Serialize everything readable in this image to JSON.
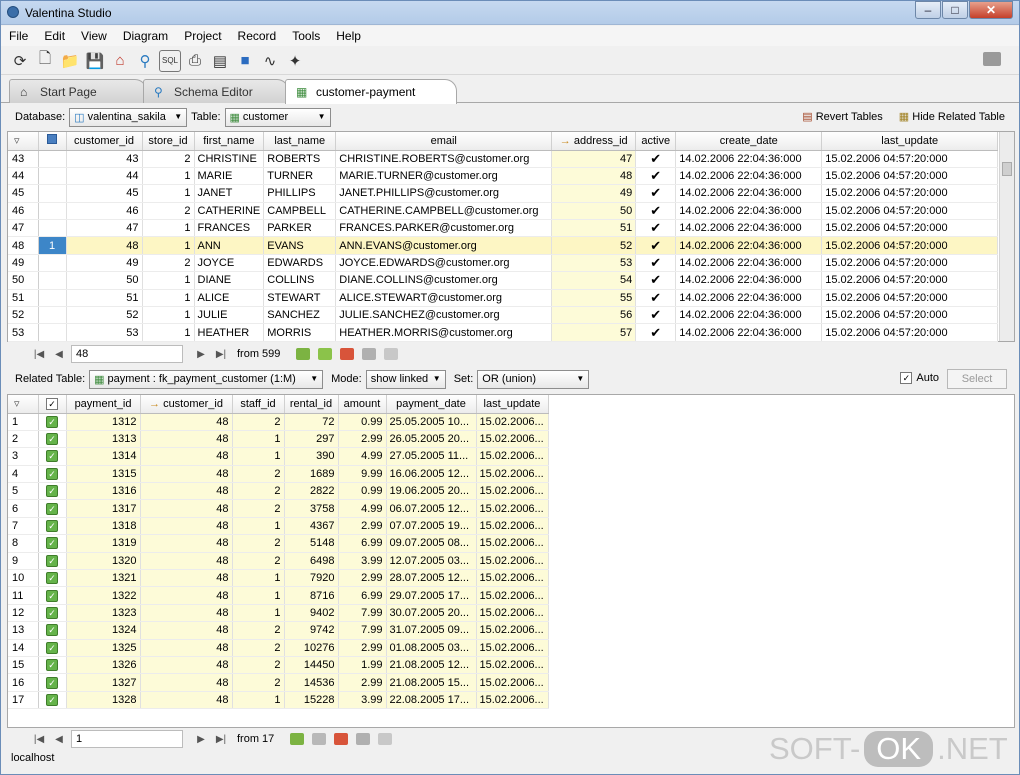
{
  "window": {
    "title": "Valentina Studio"
  },
  "menu": [
    "File",
    "Edit",
    "View",
    "Diagram",
    "Project",
    "Record",
    "Tools",
    "Help"
  ],
  "toolbar_icons": [
    "refresh-icon",
    "new-file-icon",
    "open-folder-icon",
    "save-icon",
    "home-icon",
    "search-icon",
    "sql-icon",
    "print-icon",
    "report-icon",
    "book-icon",
    "chart-icon",
    "wand-icon"
  ],
  "tabs": [
    {
      "label": "Start Page",
      "icon": "home-icon"
    },
    {
      "label": "Schema Editor",
      "icon": "schema-icon"
    },
    {
      "label": "customer-payment",
      "icon": "table-icon"
    }
  ],
  "dbbar": {
    "database_label": "Database:",
    "database_value": "valentina_sakila",
    "table_label": "Table:",
    "table_value": "customer",
    "revert": "Revert Tables",
    "hide": "Hide Related Table"
  },
  "customer": {
    "columns": [
      "customer_id",
      "store_id",
      "first_name",
      "last_name",
      "email",
      "address_id",
      "active",
      "create_date",
      "last_update"
    ],
    "rows": [
      {
        "rn": "43",
        "customer_id": "43",
        "store_id": "2",
        "first_name": "CHRISTINE",
        "last_name": "ROBERTS",
        "email": "CHRISTINE.ROBERTS@customer.org",
        "address_id": "47",
        "create_date": "14.02.2006 22:04:36:000",
        "last_update": "15.02.2006 04:57:20:000"
      },
      {
        "rn": "44",
        "customer_id": "44",
        "store_id": "1",
        "first_name": "MARIE",
        "last_name": "TURNER",
        "email": "MARIE.TURNER@customer.org",
        "address_id": "48",
        "create_date": "14.02.2006 22:04:36:000",
        "last_update": "15.02.2006 04:57:20:000"
      },
      {
        "rn": "45",
        "customer_id": "45",
        "store_id": "1",
        "first_name": "JANET",
        "last_name": "PHILLIPS",
        "email": "JANET.PHILLIPS@customer.org",
        "address_id": "49",
        "create_date": "14.02.2006 22:04:36:000",
        "last_update": "15.02.2006 04:57:20:000"
      },
      {
        "rn": "46",
        "customer_id": "46",
        "store_id": "2",
        "first_name": "CATHERINE",
        "last_name": "CAMPBELL",
        "email": "CATHERINE.CAMPBELL@customer.org",
        "address_id": "50",
        "create_date": "14.02.2006 22:04:36:000",
        "last_update": "15.02.2006 04:57:20:000"
      },
      {
        "rn": "47",
        "customer_id": "47",
        "store_id": "1",
        "first_name": "FRANCES",
        "last_name": "PARKER",
        "email": "FRANCES.PARKER@customer.org",
        "address_id": "51",
        "create_date": "14.02.2006 22:04:36:000",
        "last_update": "15.02.2006 04:57:20:000"
      },
      {
        "rn": "48",
        "customer_id": "48",
        "store_id": "1",
        "first_name": "ANN",
        "last_name": "EVANS",
        "email": "ANN.EVANS@customer.org",
        "address_id": "52",
        "create_date": "14.02.2006 22:04:36:000",
        "last_update": "15.02.2006 04:57:20:000",
        "selected": true,
        "marker": "1"
      },
      {
        "rn": "49",
        "customer_id": "49",
        "store_id": "2",
        "first_name": "JOYCE",
        "last_name": "EDWARDS",
        "email": "JOYCE.EDWARDS@customer.org",
        "address_id": "53",
        "create_date": "14.02.2006 22:04:36:000",
        "last_update": "15.02.2006 04:57:20:000"
      },
      {
        "rn": "50",
        "customer_id": "50",
        "store_id": "1",
        "first_name": "DIANE",
        "last_name": "COLLINS",
        "email": "DIANE.COLLINS@customer.org",
        "address_id": "54",
        "create_date": "14.02.2006 22:04:36:000",
        "last_update": "15.02.2006 04:57:20:000"
      },
      {
        "rn": "51",
        "customer_id": "51",
        "store_id": "1",
        "first_name": "ALICE",
        "last_name": "STEWART",
        "email": "ALICE.STEWART@customer.org",
        "address_id": "55",
        "create_date": "14.02.2006 22:04:36:000",
        "last_update": "15.02.2006 04:57:20:000"
      },
      {
        "rn": "52",
        "customer_id": "52",
        "store_id": "1",
        "first_name": "JULIE",
        "last_name": "SANCHEZ",
        "email": "JULIE.SANCHEZ@customer.org",
        "address_id": "56",
        "create_date": "14.02.2006 22:04:36:000",
        "last_update": "15.02.2006 04:57:20:000"
      },
      {
        "rn": "53",
        "customer_id": "53",
        "store_id": "1",
        "first_name": "HEATHER",
        "last_name": "MORRIS",
        "email": "HEATHER.MORRIS@customer.org",
        "address_id": "57",
        "create_date": "14.02.2006 22:04:36:000",
        "last_update": "15.02.2006 04:57:20:000"
      }
    ]
  },
  "nav1": {
    "value": "48",
    "from": "from 599"
  },
  "relbar": {
    "related_label": "Related Table:",
    "related_value": "payment : fk_payment_customer (1:M)",
    "mode_label": "Mode:",
    "mode_value": "show linked",
    "set_label": "Set:",
    "set_value": "OR (union)",
    "auto": "Auto",
    "select": "Select"
  },
  "payment": {
    "columns": [
      "payment_id",
      "customer_id",
      "staff_id",
      "rental_id",
      "amount",
      "payment_date",
      "last_update"
    ],
    "rows": [
      {
        "rn": "1",
        "payment_id": "1312",
        "customer_id": "48",
        "staff_id": "2",
        "rental_id": "72",
        "amount": "0.99",
        "payment_date": "25.05.2005 10...",
        "last_update": "15.02.2006..."
      },
      {
        "rn": "2",
        "payment_id": "1313",
        "customer_id": "48",
        "staff_id": "1",
        "rental_id": "297",
        "amount": "2.99",
        "payment_date": "26.05.2005 20...",
        "last_update": "15.02.2006..."
      },
      {
        "rn": "3",
        "payment_id": "1314",
        "customer_id": "48",
        "staff_id": "1",
        "rental_id": "390",
        "amount": "4.99",
        "payment_date": "27.05.2005 11...",
        "last_update": "15.02.2006..."
      },
      {
        "rn": "4",
        "payment_id": "1315",
        "customer_id": "48",
        "staff_id": "2",
        "rental_id": "1689",
        "amount": "9.99",
        "payment_date": "16.06.2005 12...",
        "last_update": "15.02.2006..."
      },
      {
        "rn": "5",
        "payment_id": "1316",
        "customer_id": "48",
        "staff_id": "2",
        "rental_id": "2822",
        "amount": "0.99",
        "payment_date": "19.06.2005 20...",
        "last_update": "15.02.2006..."
      },
      {
        "rn": "6",
        "payment_id": "1317",
        "customer_id": "48",
        "staff_id": "2",
        "rental_id": "3758",
        "amount": "4.99",
        "payment_date": "06.07.2005 12...",
        "last_update": "15.02.2006..."
      },
      {
        "rn": "7",
        "payment_id": "1318",
        "customer_id": "48",
        "staff_id": "1",
        "rental_id": "4367",
        "amount": "2.99",
        "payment_date": "07.07.2005 19...",
        "last_update": "15.02.2006..."
      },
      {
        "rn": "8",
        "payment_id": "1319",
        "customer_id": "48",
        "staff_id": "2",
        "rental_id": "5148",
        "amount": "6.99",
        "payment_date": "09.07.2005 08...",
        "last_update": "15.02.2006..."
      },
      {
        "rn": "9",
        "payment_id": "1320",
        "customer_id": "48",
        "staff_id": "2",
        "rental_id": "6498",
        "amount": "3.99",
        "payment_date": "12.07.2005 03...",
        "last_update": "15.02.2006..."
      },
      {
        "rn": "10",
        "payment_id": "1321",
        "customer_id": "48",
        "staff_id": "1",
        "rental_id": "7920",
        "amount": "2.99",
        "payment_date": "28.07.2005 12...",
        "last_update": "15.02.2006..."
      },
      {
        "rn": "11",
        "payment_id": "1322",
        "customer_id": "48",
        "staff_id": "1",
        "rental_id": "8716",
        "amount": "6.99",
        "payment_date": "29.07.2005 17...",
        "last_update": "15.02.2006..."
      },
      {
        "rn": "12",
        "payment_id": "1323",
        "customer_id": "48",
        "staff_id": "1",
        "rental_id": "9402",
        "amount": "7.99",
        "payment_date": "30.07.2005 20...",
        "last_update": "15.02.2006..."
      },
      {
        "rn": "13",
        "payment_id": "1324",
        "customer_id": "48",
        "staff_id": "2",
        "rental_id": "9742",
        "amount": "7.99",
        "payment_date": "31.07.2005 09...",
        "last_update": "15.02.2006..."
      },
      {
        "rn": "14",
        "payment_id": "1325",
        "customer_id": "48",
        "staff_id": "2",
        "rental_id": "10276",
        "amount": "2.99",
        "payment_date": "01.08.2005 03...",
        "last_update": "15.02.2006..."
      },
      {
        "rn": "15",
        "payment_id": "1326",
        "customer_id": "48",
        "staff_id": "2",
        "rental_id": "14450",
        "amount": "1.99",
        "payment_date": "21.08.2005 12...",
        "last_update": "15.02.2006..."
      },
      {
        "rn": "16",
        "payment_id": "1327",
        "customer_id": "48",
        "staff_id": "2",
        "rental_id": "14536",
        "amount": "2.99",
        "payment_date": "21.08.2005 15...",
        "last_update": "15.02.2006..."
      },
      {
        "rn": "17",
        "payment_id": "1328",
        "customer_id": "48",
        "staff_id": "1",
        "rental_id": "15228",
        "amount": "3.99",
        "payment_date": "22.08.2005 17...",
        "last_update": "15.02.2006..."
      }
    ]
  },
  "nav2": {
    "value": "1",
    "from": "from 17"
  },
  "status": {
    "host": "localhost"
  },
  "watermark": {
    "left": "SOFT-",
    "ok": "OK",
    ".net": ".NET"
  },
  "colors": {
    "highlight": "#fdfbd8",
    "selected_row": "#fdf6c4",
    "check_green": "#65b34a"
  }
}
